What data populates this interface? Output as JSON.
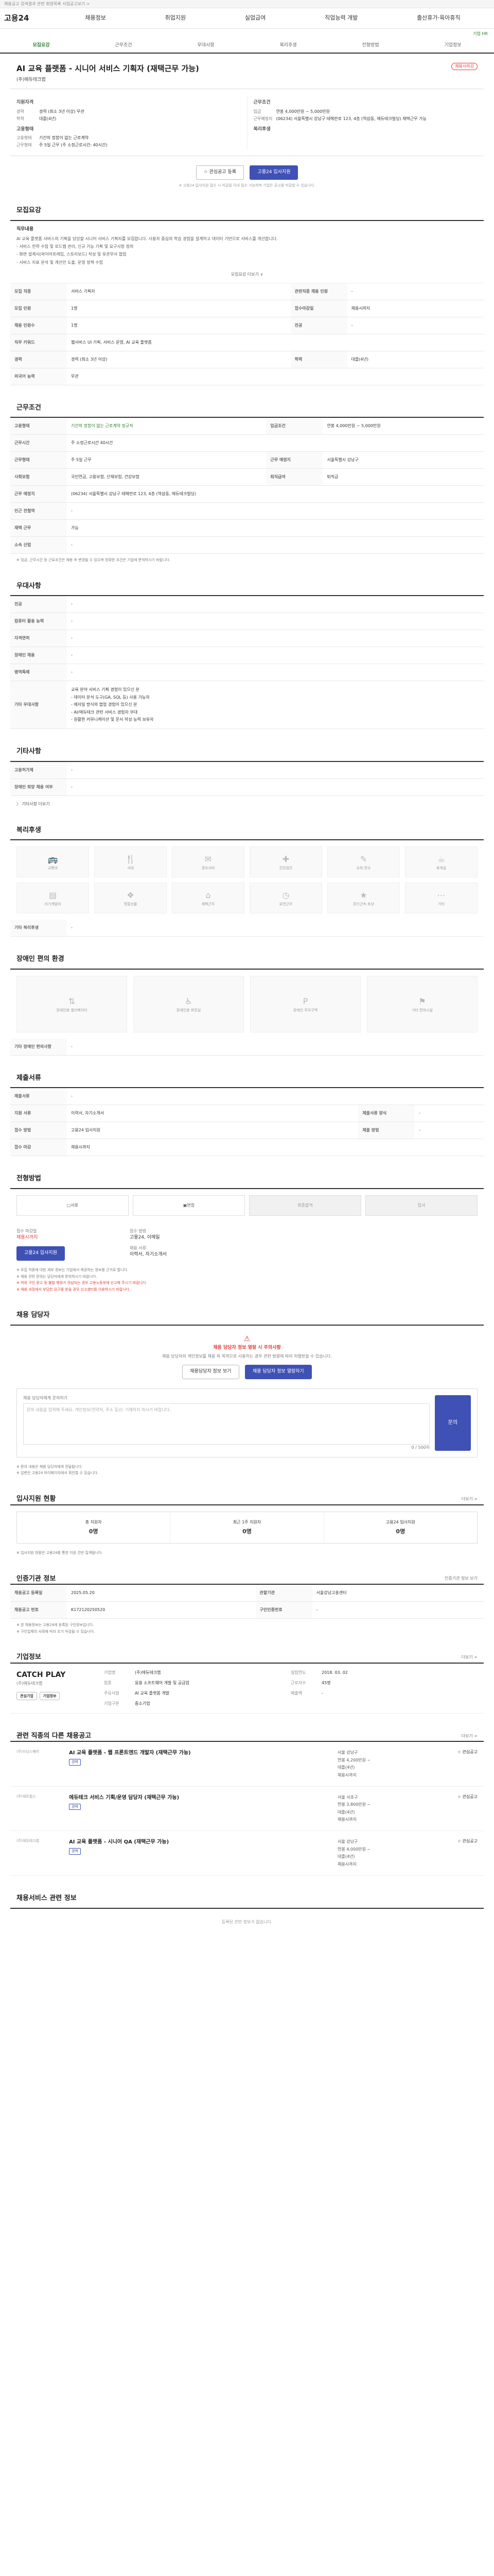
{
  "topbar": "채용공고 검색결과 관련 회원목록 사업공고보기 >",
  "header": {
    "logo": "고용24",
    "nav": [
      "채용정보",
      "취업지원",
      "실업급여",
      "직업능력 개발",
      "출산휴가·육아휴직"
    ],
    "right_link": "기업 HR"
  },
  "tabs": [
    "모집요강",
    "근무조건",
    "우대사항",
    "복리후생",
    "전형방법",
    "기업정보"
  ],
  "job": {
    "title": "AI 교육 플랫폼 - 시니어 서비스 기획자 (재택근무 가능)",
    "org": "(주)에듀테크랩",
    "badge": "채용시마감",
    "left_title": "지원자격",
    "kv_left": [
      {
        "k": "경력",
        "v": "경력 (최소 3년 이상) 무관"
      },
      {
        "k": "학력",
        "v": "대졸(4년)"
      }
    ],
    "left_title2": "고용형태",
    "kv_left2": [
      {
        "k": "고용형태",
        "v": "기간의 정함이 없는 근로계약"
      },
      {
        "k": "근무형태",
        "v": "주 5일 근무 (주 소정근로시간: 40시간)"
      }
    ],
    "right_title": "근무조건",
    "kv_right": [
      {
        "k": "임금",
        "v": "연봉 4,000만원 ~ 5,000만원"
      },
      {
        "k": "근무예정지",
        "v": "(06234) 서울특별시 강남구 테헤란로 123, 4층 (역삼동, 에듀테크빌딩) 재택근무 가능"
      }
    ],
    "right_title2": "복리후생",
    "btn_interest": "관심공고 등록",
    "btn_apply": "고용24 입사지원",
    "apply_note": "※ 고용24 입사지원 접수 시 마감일 이내 접수 가능하며 기업은 공고를 마감할 수 있습니다."
  },
  "sections": {
    "recruit": {
      "heading": "모집요강",
      "duty_title": "직무내용",
      "duty_lines": [
        "AI 교육 플랫폼 서비스의 기획을 담당할 시니어 서비스 기획자를 모집합니다. 사용자 중심의 학습 경험을 설계하고 데이터 기반으로 서비스를 개선합니다.",
        "- 서비스 전략 수립 및 로드맵 관리, 신규 기능 기획 및 요구사항 정의",
        "- 화면 설계서(와이어프레임, 스토리보드) 작성 및 유관부서 협업",
        "- 서비스 지표 분석 및 개선안 도출, 운영 정책 수립"
      ],
      "more": "모집요강 더보기 ∨",
      "rows": [
        {
          "k": "모집 직종",
          "v": "서비스 기획자",
          "k2": "관련직종 채용 인원",
          "v2": "-"
        },
        {
          "k": "모집 인원",
          "v": "1명",
          "k2": "접수마감일",
          "v2": "채용시까지"
        },
        {
          "k": "채용 인원수",
          "v": "1명",
          "k2": "전공",
          "v2": "-"
        },
        {
          "k": "직무 키워드",
          "v": "웹서비스 UI 기획, 서비스 운영, AI 교육 플랫폼",
          "k2": "",
          "v2": ""
        },
        {
          "k": "경력",
          "v": "경력 (최소 3년 이상)",
          "k2": "학력",
          "v2": "대졸(4년)"
        },
        {
          "k": "외국어 능력",
          "v": "무관",
          "k2": "",
          "v2": ""
        }
      ]
    },
    "conditions": {
      "heading": "근무조건",
      "rows": [
        {
          "k": "고용형태",
          "v": "기간의 정함이 없는 근로계약 정규직",
          "k2": "임금조건",
          "v2": "연봉 4,000만원 ~ 5,000만원"
        },
        {
          "k": "근무시간",
          "v": "주 소정근로시간 40시간",
          "k2": "",
          "v2": ""
        },
        {
          "k": "근무형태",
          "v": "주 5일 근무",
          "k2": "근무 예정지",
          "v2": "서울특별시 강남구"
        },
        {
          "k": "사회보험",
          "v": "국민연금, 고용보험, 산재보험, 건강보험",
          "k2": "퇴직급여",
          "v2": "퇴직금"
        },
        {
          "k": "근무 예정지",
          "v": "(06234) 서울특별시 강남구 테헤란로 123, 4층 (역삼동, 에듀테크빌딩)",
          "k2": "",
          "v2": ""
        },
        {
          "k": "인근 전철역",
          "v": "-",
          "k2": "",
          "v2": ""
        },
        {
          "k": "재택 근무",
          "v": "가능",
          "k2": "",
          "v2": ""
        },
        {
          "k": "소속 산업",
          "v": "-",
          "k2": "",
          "v2": ""
        }
      ],
      "note": "※ 임금, 근무시간 등 근로조건은 채용 후 변경될 수 있으며 정확한 조건은 기업에 문의하시기 바랍니다."
    },
    "preference": {
      "heading": "우대사항",
      "rows": [
        {
          "k": "전공",
          "v": "-"
        },
        {
          "k": "컴퓨터 활용 능력",
          "v": "-"
        },
        {
          "k": "자격면허",
          "v": "-"
        },
        {
          "k": "장애인 채용",
          "v": "-"
        },
        {
          "k": "병역특례",
          "v": "-"
        }
      ],
      "extra_k": "기타 우대사항",
      "extra_lines": [
        "교육 분야 서비스 기획 경험이 있으신 분",
        "- 데이터 분석 도구(GA, SQL 등) 사용 가능자",
        "- 애자일 방식의 협업 경험이 있으신 분",
        "- AI/에듀테크 관련 서비스 경험자 우대",
        "- 원활한 커뮤니케이션 및 문서 작성 능력 보유자"
      ]
    },
    "other": {
      "heading": "기타사항",
      "rows": [
        {
          "k": "고용허가제",
          "v": "-"
        },
        {
          "k": "장애인 희망 채용 여부",
          "v": "-"
        }
      ],
      "more": "기타사항 더보기"
    },
    "welfare": {
      "heading": "복리후생",
      "icons": [
        "교통비",
        "식대",
        "경조사비",
        "건강검진",
        "교육·연수",
        "휴게실",
        "자기계발비",
        "명절선물",
        "재택근무",
        "유연근무",
        "장기근속 포상",
        "기타"
      ],
      "etc_label": "기타 복리후생",
      "etc_value": "-"
    },
    "disability": {
      "heading": "장애인 편의 환경",
      "icons": [
        "장애인용 엘리베이터",
        "장애인용 화장실",
        "장애인 주차구역",
        "기타 편의시설"
      ],
      "etc_label": "기타 장애인 편의사항",
      "etc_value": "-"
    },
    "selection_docs": {
      "heading": "제출서류",
      "rows": [
        {
          "k": "제출서류",
          "v": "-",
          "k2": "",
          "v2": ""
        },
        {
          "k": "지원 서류",
          "v": "이력서, 자기소개서",
          "k2": "제출서류 양식",
          "v2": "-"
        },
        {
          "k": "접수 방법",
          "v": "고용24 입사지원",
          "k2": "제출 방법",
          "v2": "-"
        },
        {
          "k": "접수 마감",
          "v": "채용시까지",
          "k2": "",
          "v2": ""
        }
      ]
    },
    "process": {
      "heading": "전형방법",
      "steps": [
        "서류",
        "면접",
        "최종합격",
        "입사"
      ],
      "apply_title": "접수 마감일",
      "apply_value": "채용시까지",
      "apply_btn": "고용24 입사지원",
      "method_title": "접수 방법",
      "method_value": "고용24, 이메일",
      "contact_title": "채용 서류",
      "contact_value": "이력서, 자기소개서",
      "notes": [
        "※ 모집 직종에 대한 세부 정보는 기업에서 제공하는 정보를 근거로 합니다.",
        "※ 채용 관련 문의는 담당자에게 문의하시기 바랍니다."
      ],
      "red_notes": [
        "※ 허위 구인 광고 등 불법 행위가 의심되는 경우 고용노동부에 신고해 주시기 바랍니다.",
        "※ 채용 과정에서 부당한 요구를 받을 경우 신고센터를 이용하시기 바랍니다."
      ]
    },
    "manager": {
      "heading": "채용 담당자",
      "alert": "채용 담당자 정보 열람 시 주의사항",
      "alert_desc": "채용 담당자의 개인정보를 채용 외 목적으로 사용하는 경우 관련 법령에 따라 처벌받을 수 있습니다.",
      "btn_view": "채용담당자 정보 보기",
      "btn_private": "채용 담당자 정보 열람하기",
      "inq_title": "채용 담당자에게 문의하기",
      "inq_placeholder": "문의 내용을 입력해 주세요. 개인정보(연락처, 주소 등)는 기재하지 마시기 바랍니다.",
      "inq_btn": "문의",
      "inq_count": "0 / 500자",
      "notes": [
        "※ 문의 내용은 채용 담당자에게 전달됩니다.",
        "※ 답변은 고용24 마이페이지에서 확인할 수 있습니다."
      ]
    },
    "status": {
      "heading": "입사지원 현황",
      "link": "더보기 >",
      "items": [
        {
          "label": "총 지원자",
          "value": "0명"
        },
        {
          "label": "최근 1주 지원자",
          "value": "0명"
        },
        {
          "label": "고용24 입사지원",
          "value": "0명"
        }
      ],
      "note": "※ 입사지원 현황은 고용24를 통한 지원 건만 집계됩니다."
    },
    "reginfo": {
      "heading": "인증기관 정보",
      "link": "인증기관 정보 보기",
      "rows": [
        {
          "k": "채용공고 등록일",
          "v": "2025.05.20",
          "k2": "관할기관",
          "v2": "서울강남고용센터"
        },
        {
          "k": "채용공고 번호",
          "v": "K172120250520",
          "k2": "구인인증번호",
          "v2": "-"
        }
      ],
      "notes": [
        "※ 본 채용정보는 고용24에 등록된 구인정보입니다.",
        "※ 구인업체의 사정에 따라 조기 마감될 수 있습니다."
      ]
    },
    "company": {
      "heading": "기업정보",
      "link": "더보기 >",
      "logo": "CATCH PLAY",
      "name": "(주)에듀테크랩",
      "btn1": "관심기업",
      "btn2": "기업정보",
      "rows": [
        {
          "k": "기업명",
          "v": "(주)에듀테크랩",
          "k2": "설립연도",
          "v2": "2018. 03. 02"
        },
        {
          "k": "업종",
          "v": "응용 소프트웨어 개발 및 공급업",
          "k2": "근로자수",
          "v2": "45명"
        },
        {
          "k": "주요사업",
          "v": "AI 교육 플랫폼 개발",
          "k2": "매출액",
          "v2": "-"
        },
        {
          "k": "기업구분",
          "v": "중소기업",
          "k2": "",
          "v2": ""
        }
      ]
    },
    "similar": {
      "heading": "관련 직종의 다른 채용공고",
      "link": "더보기 >",
      "items": [
        {
          "company": "(주)러닝스퀘어",
          "title": "AI 교육 플랫폼 - 웹 프론트엔드 개발자 (재택근무 가능)",
          "tag": "경력",
          "info": [
            "서울 강남구",
            "연봉 4,200만원 ~",
            "대졸(4년)",
            "채용시까지"
          ],
          "score": "관심공고"
        },
        {
          "company": "(주)에듀랩스",
          "title": "에듀테크 서비스 기획/운영 담당자 (재택근무 가능)",
          "tag": "경력",
          "info": [
            "서울 서초구",
            "연봉 3,800만원 ~",
            "대졸(4년)",
            "채용시까지"
          ],
          "score": "관심공고"
        },
        {
          "company": "(주)에듀테크랩",
          "title": "AI 교육 플랫폼 - 시니어 QA (재택근무 가능)",
          "tag": "경력",
          "info": [
            "서울 강남구",
            "연봉 4,000만원 ~",
            "대졸(4년)",
            "채용시까지"
          ],
          "score": "관심공고"
        }
      ]
    },
    "footer": {
      "heading": "채용서비스 관련 정보",
      "text": "등록된 관련 정보가 없습니다."
    }
  },
  "colors": {
    "accent": "#3f51b5",
    "brand": "#2e7d32",
    "alert": "#e53935"
  }
}
